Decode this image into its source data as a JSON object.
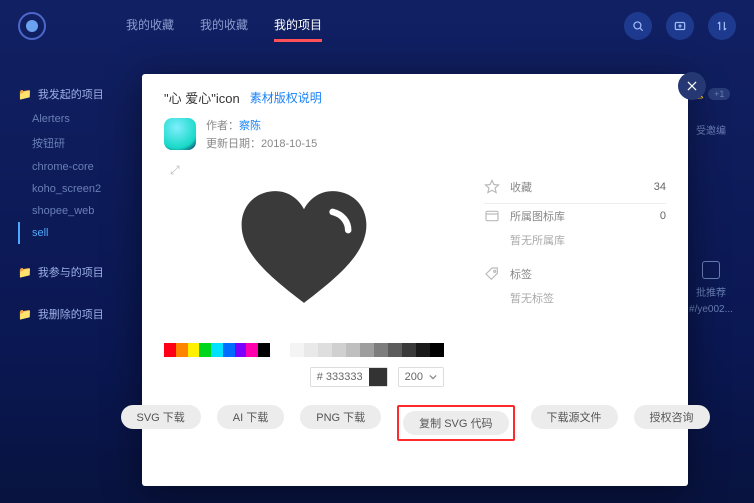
{
  "nav": {
    "items": [
      "我的收藏",
      "我的收藏",
      "我的项目"
    ],
    "activeIndex": 2
  },
  "sidebar": {
    "group1_title": "我发起的项目",
    "items": [
      "Alerters",
      "按钮研",
      "chrome-core",
      "koho_screen2",
      "shopee_web",
      "sell"
    ],
    "activeIndex": 5,
    "group2_title": "我参与的项目",
    "group3_title": "我删除的项目"
  },
  "right": {
    "badge": "+1",
    "sub_link": "受邀编",
    "t_label": "批推荐",
    "t_code": "#/ye002..."
  },
  "modal": {
    "title": "\"心 爱心\"icon",
    "copyright_link": "素材版权说明",
    "author_label": "作者：",
    "author_name": "察陈",
    "date_label": "更新日期：",
    "date_value": "2018-10-15",
    "color_value": "# 333333",
    "size_value": "200",
    "details": {
      "fav_label": "收藏",
      "fav_count": "34",
      "lib_label": "所属图标库",
      "lib_count": "0",
      "lib_empty": "暂无所属库",
      "tag_label": "标签",
      "tag_empty": "暂无标签"
    },
    "buttons": [
      "SVG 下载",
      "AI 下载",
      "PNG 下载",
      "复制 SVG 代码",
      "下载源文件",
      "授权咨询"
    ]
  },
  "swatches": [
    "#ff0016",
    "#ff8400",
    "#fff000",
    "#00d61b",
    "#00e1ff",
    "#006dff",
    "#7a00ff",
    "#ff00ae",
    "#000000"
  ],
  "grays": [
    "#ffffff",
    "#f4f4f4",
    "#e9e9e9",
    "#dedede",
    "#d0d0d0",
    "#bfbfbf",
    "#9e9e9e",
    "#7d7d7d",
    "#5c5c5c",
    "#3a3a3a",
    "#1a1a1a",
    "#000000"
  ]
}
